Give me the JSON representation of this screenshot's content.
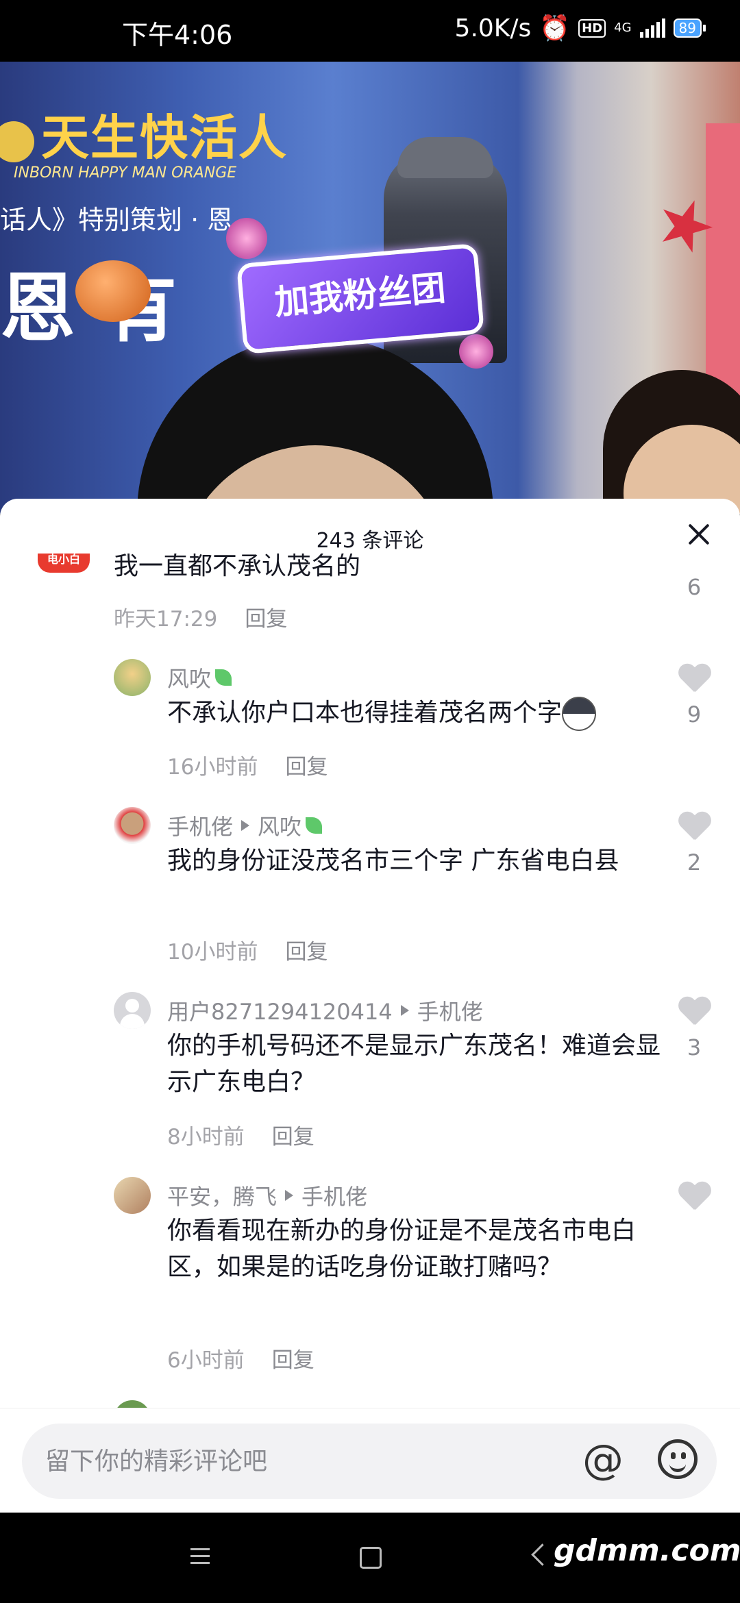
{
  "status_bar": {
    "time": "下午4:06",
    "net_speed": "5.0K/s",
    "network": "4G",
    "battery": "89"
  },
  "video": {
    "show_title": "天生快活人",
    "show_subtitle": "INBORN HAPPY MAN ORANGE",
    "banner_line": "话人》特别策划 · 恩",
    "banner_big": "恩  有",
    "fan_badge": "加我粉丝团"
  },
  "comments_sheet": {
    "title": "243 条评论",
    "comments": [
      {
        "text": "我一直都不承认茂名的",
        "time": "昨天17:29",
        "reply_label": "回复",
        "likes": "6"
      },
      {
        "user": "风吹",
        "text": "不承认你户口本也得挂着茂名两个字",
        "time": "16小时前",
        "reply_label": "回复",
        "likes": "9"
      },
      {
        "user": "手机佬",
        "reply_to": "风吹",
        "text": "我的身份证没茂名市三个字 广东省电白县",
        "time": "10小时前",
        "reply_label": "回复",
        "likes": "2"
      },
      {
        "user": "用户8271294120414",
        "reply_to": "手机佬",
        "text": "你的手机号码还不是显示广东茂名！难道会显示广东电白？",
        "time": "8小时前",
        "reply_label": "回复",
        "likes": "3"
      },
      {
        "user": "平安，腾飞",
        "reply_to": "手机佬",
        "text": "你看看现在新办的身份证是不是茂名市电白区，如果是的话吃身份证敢打赌吗？",
        "time": "6小时前",
        "reply_label": "回复",
        "likes": ""
      }
    ]
  },
  "input_bar": {
    "placeholder": "留下你的精彩评论吧",
    "at_label": "@"
  },
  "nav_bar": {
    "watermark": "gdmm.com"
  },
  "colors": {
    "sheet_bg": "#ffffff",
    "text_primary": "#161823",
    "text_secondary": "#8a8b91",
    "like_icon": "#d0d0d4"
  },
  "icons": [
    "alarm-icon",
    "hd-icon",
    "signal-icon",
    "battery-icon",
    "close-icon",
    "heart-icon",
    "leaf-icon",
    "reply-arrow-icon",
    "husky-emoji-icon",
    "at-icon",
    "emoji-icon",
    "menu-icon",
    "home-icon",
    "back-icon"
  ]
}
